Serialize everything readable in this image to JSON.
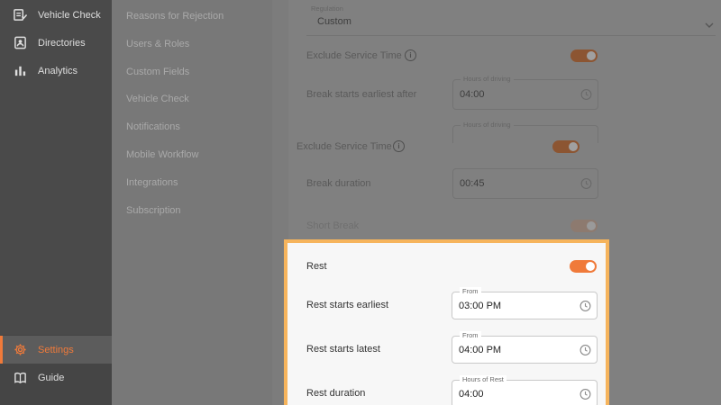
{
  "nav": {
    "items": [
      {
        "label": "Vehicle Check",
        "icon": "vehicle-check-icon"
      },
      {
        "label": "Directories",
        "icon": "directories-icon"
      },
      {
        "label": "Analytics",
        "icon": "analytics-icon"
      }
    ],
    "bottom_items": [
      {
        "label": "Settings",
        "icon": "gear-icon",
        "active": true
      },
      {
        "label": "Guide",
        "icon": "book-icon"
      }
    ]
  },
  "submenu": {
    "items": [
      {
        "label": "Reasons for Rejection"
      },
      {
        "label": "Users & Roles"
      },
      {
        "label": "Custom Fields"
      },
      {
        "label": "Vehicle Check"
      },
      {
        "label": "Notifications"
      },
      {
        "label": "Mobile Workflow"
      },
      {
        "label": "Integrations"
      },
      {
        "label": "Subscription"
      }
    ]
  },
  "content": {
    "regulation": {
      "label": "Regulation",
      "value": "Custom"
    },
    "exclude_service_time_1": {
      "label": "Exclude Service Time",
      "enabled": true
    },
    "break_starts": {
      "label": "Break starts earliest after",
      "field_label": "Hours of driving",
      "value": "04:00"
    },
    "hours_of_driving_label": "Hours of driving",
    "exclude_service_time_2": {
      "label": "Exclude Service Time",
      "enabled": true
    },
    "break_duration": {
      "label": "Break duration",
      "value": "00:45"
    },
    "short_break": {
      "label": "Short Break",
      "enabled": false
    }
  },
  "rest": {
    "label": "Rest",
    "enabled": true,
    "starts_earliest": {
      "label": "Rest starts earliest",
      "field_label": "From",
      "value": "03:00 PM"
    },
    "starts_latest": {
      "label": "Rest starts latest",
      "field_label": "From",
      "value": "04:00 PM"
    },
    "duration": {
      "label": "Rest duration",
      "field_label": "Hours of Rest",
      "value": "04:00"
    }
  },
  "colors": {
    "accent": "#f07a3a",
    "highlight_border": "#f6b45c"
  }
}
